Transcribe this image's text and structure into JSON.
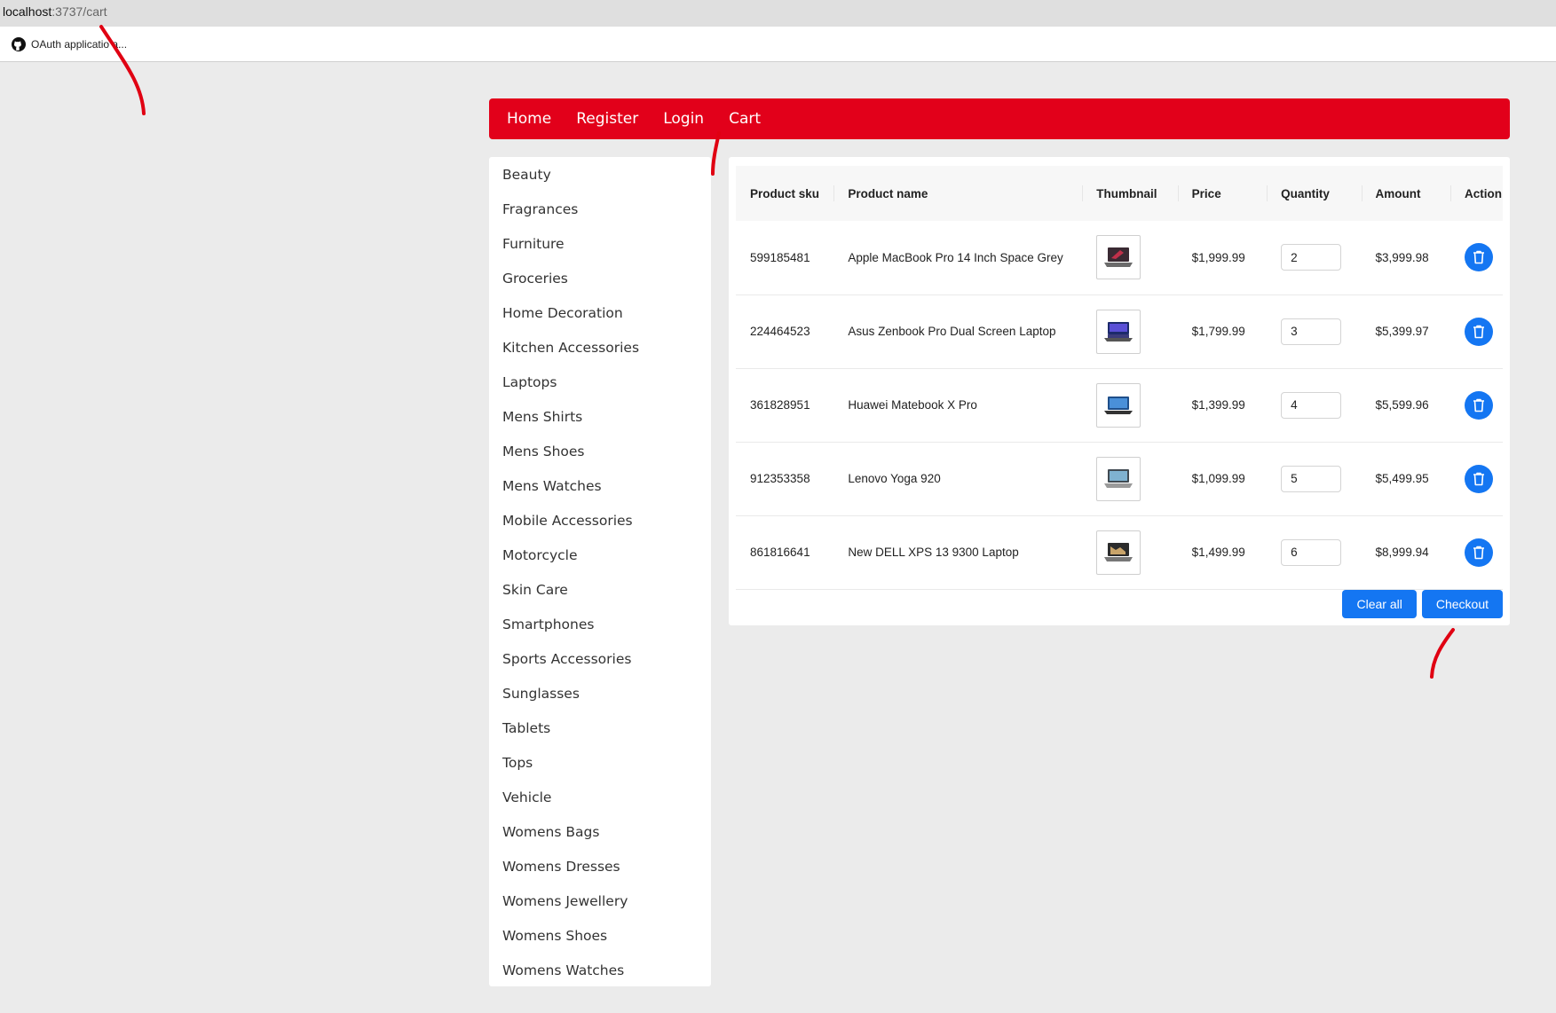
{
  "browser": {
    "url_host": "localhost",
    "url_path": ":3737/cart",
    "bookmark_label": "OAuth applicatio   a..."
  },
  "nav": {
    "items": [
      "Home",
      "Register",
      "Login",
      "Cart"
    ]
  },
  "categories": [
    "Beauty",
    "Fragrances",
    "Furniture",
    "Groceries",
    "Home Decoration",
    "Kitchen Accessories",
    "Laptops",
    "Mens Shirts",
    "Mens Shoes",
    "Mens Watches",
    "Mobile Accessories",
    "Motorcycle",
    "Skin Care",
    "Smartphones",
    "Sports Accessories",
    "Sunglasses",
    "Tablets",
    "Tops",
    "Vehicle",
    "Womens Bags",
    "Womens Dresses",
    "Womens Jewellery",
    "Womens Shoes",
    "Womens Watches"
  ],
  "cart": {
    "columns": [
      "Product sku",
      "Product name",
      "Thumbnail",
      "Price",
      "Quantity",
      "Amount",
      "Action"
    ],
    "rows": [
      {
        "sku": "599185481",
        "name": "Apple MacBook Pro 14 Inch Space Grey",
        "price": "$1,999.99",
        "quantity": "2",
        "amount": "$3,999.98"
      },
      {
        "sku": "224464523",
        "name": "Asus Zenbook Pro Dual Screen Laptop",
        "price": "$1,799.99",
        "quantity": "3",
        "amount": "$5,399.97"
      },
      {
        "sku": "361828951",
        "name": "Huawei Matebook X Pro",
        "price": "$1,399.99",
        "quantity": "4",
        "amount": "$5,599.96"
      },
      {
        "sku": "912353358",
        "name": "Lenovo Yoga 920",
        "price": "$1,099.99",
        "quantity": "5",
        "amount": "$5,499.95"
      },
      {
        "sku": "861816641",
        "name": "New DELL XPS 13 9300 Laptop",
        "price": "$1,499.99",
        "quantity": "6",
        "amount": "$8,999.94"
      }
    ],
    "clear_label": "Clear all",
    "checkout_label": "Checkout"
  },
  "colors": {
    "nav_red": "#e2001a",
    "primary_blue": "#1476f2",
    "annotation_red": "#e00012"
  },
  "icons": {
    "delete": "trash-icon",
    "bookmark": "github-icon",
    "thumbnail": "laptop-icon"
  }
}
